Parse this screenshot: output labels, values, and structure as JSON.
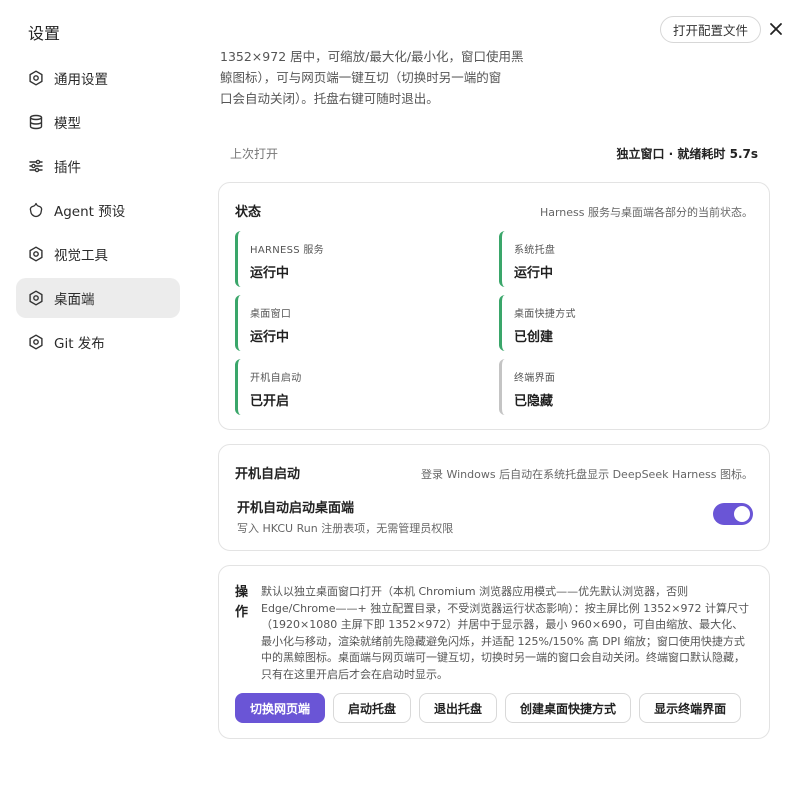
{
  "window": {
    "title": "设置",
    "open_config_label": "打开配置文件",
    "close_icon": "close-icon"
  },
  "sidebar": {
    "items": [
      {
        "label": "通用设置",
        "icon": "gear-icon",
        "active": false
      },
      {
        "label": "模型",
        "icon": "database-icon",
        "active": false
      },
      {
        "label": "插件",
        "icon": "sliders-icon",
        "active": false
      },
      {
        "label": "Agent 预设",
        "icon": "agent-icon",
        "active": false
      },
      {
        "label": "视觉工具",
        "icon": "gear-icon",
        "active": false
      },
      {
        "label": "桌面端",
        "icon": "gear-icon",
        "active": true
      },
      {
        "label": "Git 发布",
        "icon": "gear-icon",
        "active": false
      }
    ]
  },
  "top_desc": {
    "line1": "1352×972 居中，可缩放/最大化/最小化，窗口使用黑",
    "line2": "鲸图标），可与网页端一键互切（切换时另一端的窗",
    "line3": "口会自动关闭）。托盘右键可随时退出。"
  },
  "last_open": {
    "label": "上次打开",
    "value": "独立窗口 · 就绪耗时 5.7s"
  },
  "status": {
    "title": "状态",
    "subtitle": "Harness 服务与桌面端各部分的当前状态。",
    "tiles": [
      {
        "label": "HARNESS 服务",
        "value": "运行中"
      },
      {
        "label": "系统托盘",
        "value": "运行中"
      },
      {
        "label": "桌面窗口",
        "value": "运行中"
      },
      {
        "label": "桌面快捷方式",
        "value": "已创建"
      },
      {
        "label": "开机自启动",
        "value": "已开启"
      },
      {
        "label": "终端界面",
        "value": "已隐藏"
      }
    ]
  },
  "autostart": {
    "title": "开机自启动",
    "subtitle": "登录 Windows 后自动在系统托盘显示 DeepSeek Harness 图标。",
    "toggle_title": "开机自动启动桌面端",
    "toggle_sub": "写入 HKCU Run 注册表项，无需管理员权限",
    "enabled": true
  },
  "ops": {
    "title": "操作",
    "description": "默认以独立桌面窗口打开（本机 Chromium 浏览器应用模式——优先默认浏览器，否则 Edge/Chrome——+ 独立配置目录，不受浏览器运行状态影响）：按主屏比例 1352×972 计算尺寸（1920×1080 主屏下即 1352×972）并居中于显示器，最小 960×690，可自由缩放、最大化、最小化与移动，渲染就绪前先隐藏避免闪烁，并适配 125%/150% 高 DPI 缩放；窗口使用快捷方式中的黑鲸图标。桌面端与网页端可一键互切，切换时另一端的窗口会自动关闭。终端窗口默认隐藏，只有在这里开启后才会在启动时显示。",
    "buttons": [
      "切换网页端",
      "启动托盘",
      "退出托盘",
      "创建桌面快捷方式",
      "显示终端界面"
    ]
  },
  "colors": {
    "accent": "#6a55d6",
    "status_ok": "#3aa66a",
    "status_muted": "#c4c4c4"
  }
}
